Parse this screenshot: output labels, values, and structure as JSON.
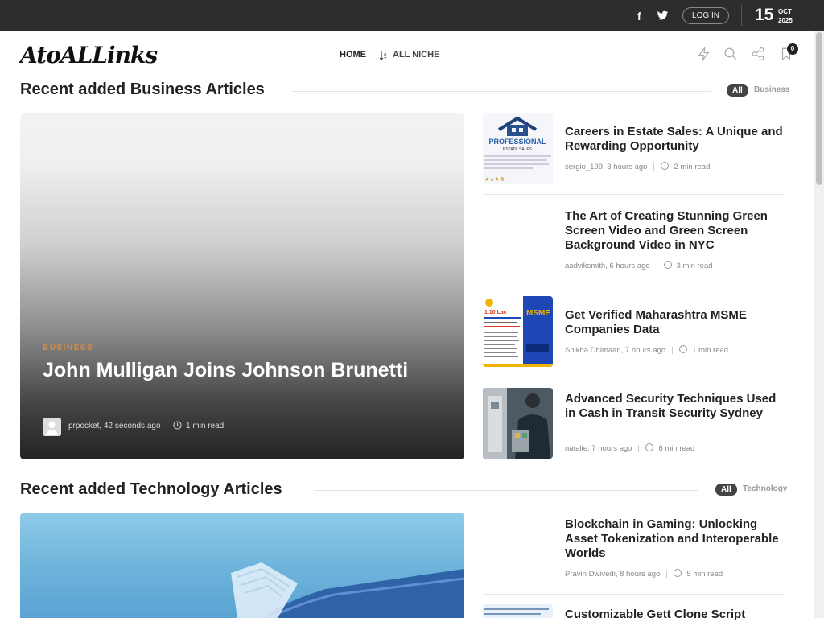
{
  "topbar": {
    "facebook_icon": "facebook-icon",
    "twitter_icon": "twitter-icon",
    "login_label": "LOG IN",
    "date_day": "15",
    "date_month": "OCT",
    "date_year": "2025"
  },
  "header": {
    "logo_text": "AtoALLinks",
    "nav": [
      {
        "label": "HOME"
      },
      {
        "label": "ALL NICHE"
      }
    ],
    "icons": [
      "lightning-icon",
      "search-icon",
      "share-icon",
      "bookmark-icon"
    ],
    "bookmark_count": "0"
  },
  "business_section": {
    "title": "Recent added Business Articles",
    "pill_all": "All",
    "pill_category": "Business",
    "hero": {
      "category": "BUSINESS",
      "title": "John Mulligan Joins Johnson Brunetti",
      "meta": "prpocket, 42 seconds ago",
      "read_time": "1 min read"
    },
    "articles": [
      {
        "title": "Careers in Estate Sales: A Unique and Rewarding Opportunity",
        "meta": "sergio_199, 3 hours ago",
        "read_time": "2 min read"
      },
      {
        "title": "The Art of Creating Stunning Green Screen Video and Green Screen Background Video in NYC",
        "meta": "aadviksmith, 6 hours ago",
        "read_time": "3 min read"
      },
      {
        "title": "Get Verified Maharashtra MSME Companies Data",
        "meta": "Shikha Dhimaan, 7 hours ago",
        "read_time": "1 min read"
      },
      {
        "title": "Advanced Security Techniques Used in Cash in Transit Security Sydney",
        "meta": "natalie, 7 hours ago",
        "read_time": "6 min read"
      }
    ],
    "thumb_texts": {
      "estate_top": "PROFESSIONAL",
      "estate_sub": "ESTATE SALES",
      "msme_price": "1.10 Lac",
      "msme_badge": "MSME"
    }
  },
  "technology_section": {
    "title": "Recent added Technology Articles",
    "pill_all": "All",
    "pill_category": "Technology",
    "articles": [
      {
        "title": "Blockchain in Gaming: Unlocking Asset Tokenization and Interoperable Worlds",
        "meta": "Pravin Dwivedi, 8 hours ago",
        "read_time": "5 min read"
      },
      {
        "title": "Customizable Gett Clone Script",
        "meta": "",
        "read_time": ""
      }
    ]
  },
  "colors": {
    "topbar": "#2d2d2d",
    "category_accent": "#d48a4a",
    "pill": "#444444"
  }
}
